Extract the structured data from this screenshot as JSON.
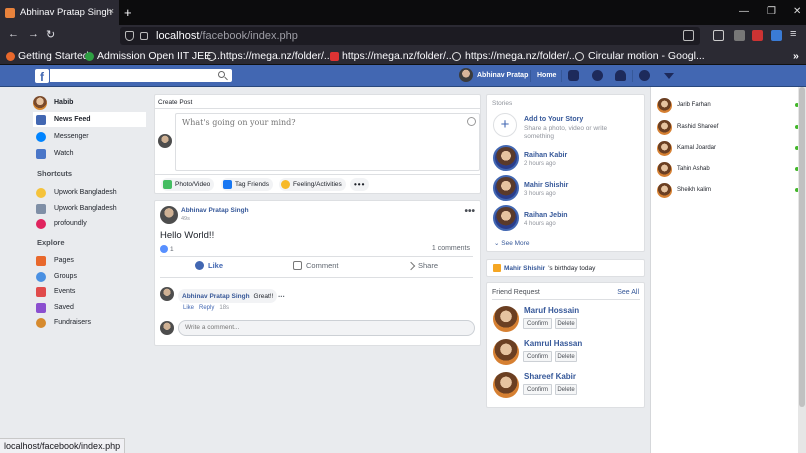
{
  "browser": {
    "tab_title": "Abhinav Pratap Singh",
    "tab_close": "×",
    "new_tab": "+",
    "url_host": "localhost",
    "url_path": "/facebook/index.php",
    "bookmarks": [
      {
        "label": "Getting Started",
        "color": "#e8682c"
      },
      {
        "label": "Admission Open IIT JEE ...",
        "color": "#2ea043"
      },
      {
        "label": "https://mega.nz/folder/...",
        "color": ""
      },
      {
        "label": "https://mega.nz/folder/...",
        "color": "#d33"
      },
      {
        "label": "https://mega.nz/folder/...",
        "color": ""
      },
      {
        "label": "Circular motion - Googl...",
        "color": ""
      }
    ],
    "status_text": "localhost/facebook/index.php"
  },
  "header": {
    "logo": "f",
    "user_name": "Abhinav Pratap",
    "home_label": "Home",
    "accent": "#4267b2"
  },
  "sidebar": {
    "profile_name": "Habib",
    "main_items": [
      {
        "label": "News Feed",
        "icon": "news-feed-icon",
        "color": "#4267b2"
      },
      {
        "label": "Messenger",
        "icon": "messenger-icon",
        "color": "#0084ff"
      },
      {
        "label": "Watch",
        "icon": "watch-icon",
        "color": "#4a76c8"
      }
    ],
    "shortcuts_title": "Shortcuts",
    "shortcuts": [
      {
        "label": "Upwork Bangladesh",
        "icon": "lightbulb-icon",
        "color": "#f5c33b"
      },
      {
        "label": "Upwork Bangladesh",
        "icon": "group-icon",
        "color": "#7f8fa6"
      },
      {
        "label": "profoundly",
        "icon": "heart-icon",
        "color": "#e0245e"
      }
    ],
    "explore_title": "Explore",
    "explore": [
      {
        "label": "Pages",
        "icon": "flag-icon",
        "color": "#e8682c"
      },
      {
        "label": "Groups",
        "icon": "groups-icon",
        "color": "#4a90e2"
      },
      {
        "label": "Events",
        "icon": "calendar-icon",
        "color": "#e04b4b"
      },
      {
        "label": "Saved",
        "icon": "bookmark-icon",
        "color": "#8b4fcf"
      },
      {
        "label": "Fundraisers",
        "icon": "fundraiser-icon",
        "color": "#d68a2e"
      }
    ]
  },
  "composer": {
    "title": "Create Post",
    "placeholder": "What's going on your mind?",
    "actions": [
      "Photo/Video",
      "Tag Friends",
      "Feeling/Activities"
    ],
    "more": "•••"
  },
  "post": {
    "author": "Abhinav Pratap Singh",
    "time": "49s",
    "text": "Hello World!!",
    "like_count": "1",
    "comments_count": "1 comments",
    "like_label": "Like",
    "comment_label": "Comment",
    "share_label": "Share",
    "comment": {
      "author": "Abhinav Pratap Singh",
      "text": "Great!!",
      "like": "Like",
      "reply": "Reply",
      "time": "18s"
    },
    "comment_placeholder": "Write a comment...",
    "dots": "•••"
  },
  "stories": {
    "title": "Stories",
    "add_title": "Add to Your Story",
    "add_subtitle": "Share a photo, video or write something",
    "items": [
      {
        "name": "Raihan Kabir",
        "time": "2 hours ago"
      },
      {
        "name": "Mahir Shishir",
        "time": "3 hours ago"
      },
      {
        "name": "Raihan Jebin",
        "time": "4 hours ago"
      }
    ],
    "see_more": "See More"
  },
  "birthday": {
    "name": "Mahir Shishir",
    "suffix": "'s birthday today"
  },
  "friend_requests": {
    "title": "Friend Request",
    "see_all": "See All",
    "confirm_label": "Confirm",
    "delete_label": "Delete",
    "items": [
      {
        "name": "Maruf Hossain"
      },
      {
        "name": "Kamrul Hassan"
      },
      {
        "name": "Shareef Kabir"
      }
    ]
  },
  "chat": {
    "contacts": [
      {
        "name": "Jarib Farhan"
      },
      {
        "name": "Rashid Shareef"
      },
      {
        "name": "Kamal Joardar"
      },
      {
        "name": "Tahin Ashab"
      },
      {
        "name": "Sheikh kalim"
      }
    ]
  }
}
